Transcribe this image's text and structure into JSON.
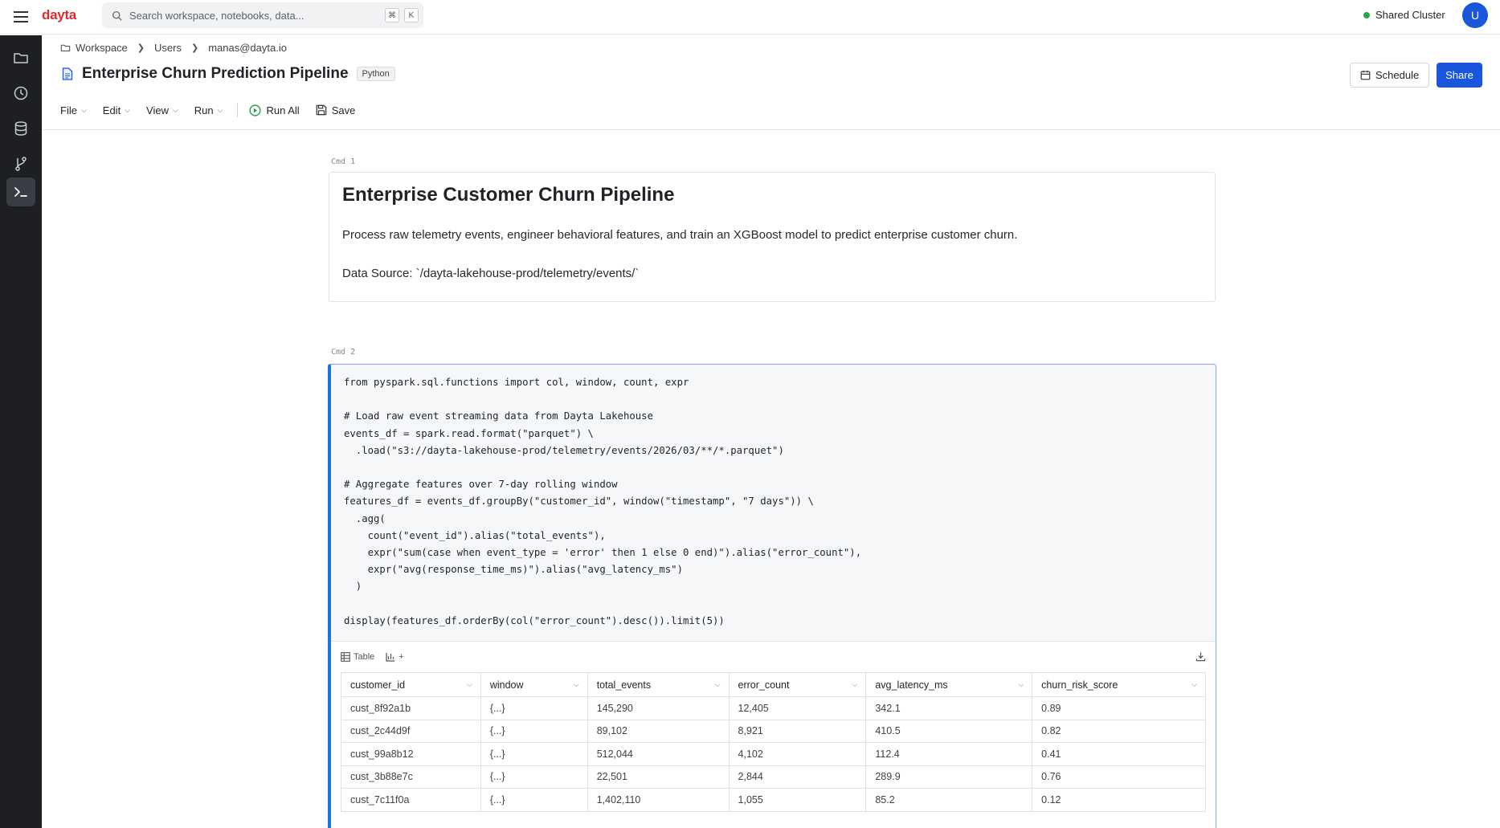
{
  "app": {
    "brand": "dayta"
  },
  "search": {
    "placeholder": "Search workspace, notebooks, data...",
    "key1": "⌘",
    "key2": "K"
  },
  "cluster": {
    "label": "Shared Cluster",
    "status_color": "#28a745"
  },
  "user": {
    "initial": "U"
  },
  "breadcrumb": [
    "Workspace",
    "Users",
    "manas@dayta.io"
  ],
  "notebook": {
    "title": "Enterprise Churn Prediction Pipeline",
    "language": "Python"
  },
  "actions": {
    "schedule": "Schedule",
    "share": "Share"
  },
  "toolbar": {
    "menus": [
      "File",
      "Edit",
      "View",
      "Run"
    ],
    "run_all": "Run All",
    "save": "Save"
  },
  "cells": {
    "cmd1": {
      "label": "Cmd 1",
      "heading": "Enterprise Customer Churn Pipeline",
      "paragraph1": "Process raw telemetry events, engineer behavioral features, and train an XGBoost model to predict enterprise customer churn.",
      "paragraph2": "Data Source: `/dayta-lakehouse-prod/telemetry/events/`"
    },
    "cmd2": {
      "label": "Cmd 2",
      "code": "from pyspark.sql.functions import col, window, count, expr\n\n# Load raw event streaming data from Dayta Lakehouse\nevents_df = spark.read.format(\"parquet\") \\\n  .load(\"s3://dayta-lakehouse-prod/telemetry/events/2026/03/**/*.parquet\")\n\n# Aggregate features over 7-day rolling window\nfeatures_df = events_df.groupBy(\"customer_id\", window(\"timestamp\", \"7 days\")) \\\n  .agg(\n    count(\"event_id\").alias(\"total_events\"),\n    expr(\"sum(case when event_type = 'error' then 1 else 0 end)\").alias(\"error_count\"),\n    expr(\"avg(response_time_ms)\").alias(\"avg_latency_ms\")\n  )\n\ndisplay(features_df.orderBy(col(\"error_count\").desc()).limit(5))",
      "result_tabs": {
        "table": "Table",
        "add": "+"
      },
      "columns": [
        "customer_id",
        "window",
        "total_events",
        "error_count",
        "avg_latency_ms",
        "churn_risk_score"
      ],
      "rows": [
        [
          "cust_8f92a1b",
          "{...}",
          "145,290",
          "12,405",
          "342.1",
          "0.89"
        ],
        [
          "cust_2c44d9f",
          "{...}",
          "89,102",
          "8,921",
          "410.5",
          "0.82"
        ],
        [
          "cust_99a8b12",
          "{...}",
          "512,044",
          "4,102",
          "112.4",
          "0.41"
        ],
        [
          "cust_3b88e7c",
          "{...}",
          "22,501",
          "2,844",
          "289.9",
          "0.76"
        ],
        [
          "cust_7c11f0a",
          "{...}",
          "1,402,110",
          "1,055",
          "85.2",
          "0.12"
        ]
      ]
    }
  },
  "colors": {
    "brand": "#e0292e",
    "accent": "#1a56db",
    "sidebar": "#1d1f23"
  }
}
